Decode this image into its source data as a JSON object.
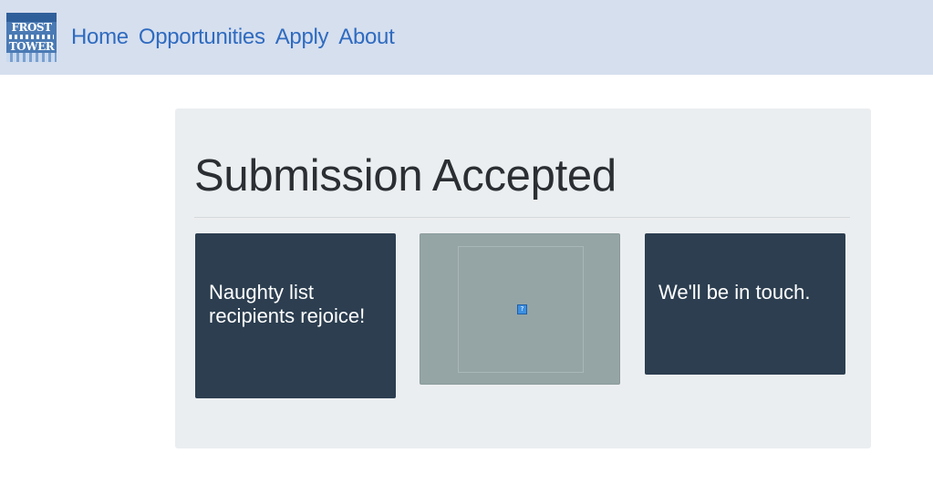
{
  "navbar": {
    "logo": {
      "line1": "FROST",
      "line2": "TOWER"
    },
    "links": [
      {
        "label": "Home"
      },
      {
        "label": "Opportunities"
      },
      {
        "label": "Apply"
      },
      {
        "label": "About"
      }
    ]
  },
  "main": {
    "title": "Submission Accepted",
    "cards": [
      {
        "text": "Naughty list recipients rejoice!"
      },
      {
        "image_icon": "broken-image-icon",
        "icon_glyph": "?"
      },
      {
        "text": "We'll be in touch."
      }
    ]
  },
  "colors": {
    "navbar_bg": "#d6dfee",
    "nav_link": "#2f6bc0",
    "panel_bg": "#ebeef0",
    "card_dark": "#2c3e50",
    "card_media": "#95a5a6"
  }
}
